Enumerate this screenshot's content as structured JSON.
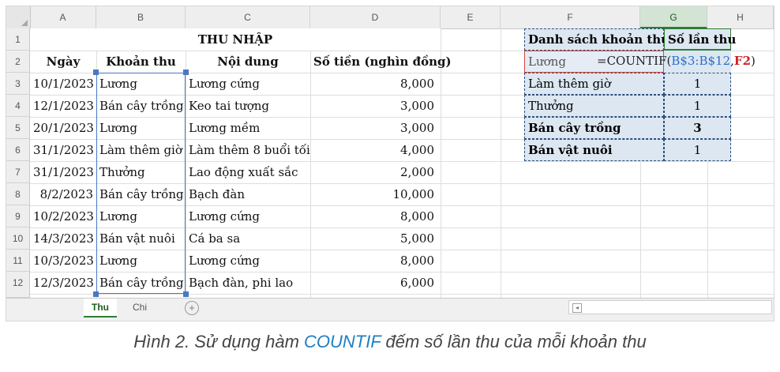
{
  "columns": [
    "A",
    "B",
    "C",
    "D",
    "E",
    "F",
    "G",
    "H"
  ],
  "selected_column": "G",
  "rows": [
    "1",
    "2",
    "3",
    "4",
    "5",
    "6",
    "7",
    "8",
    "9",
    "10",
    "11",
    "12"
  ],
  "title": "THU NHẬP",
  "headers": {
    "ngay": "Ngày",
    "khoan_thu": "Khoản thu",
    "noi_dung": "Nội dung",
    "so_tien": "Số tiền (nghìn đồng)"
  },
  "data_rows": [
    {
      "ngay": "10/1/2023",
      "khoan_thu": "Lương",
      "noi_dung": "Lương cứng",
      "so_tien": "8,000"
    },
    {
      "ngay": "12/1/2023",
      "khoan_thu": "Bán cây trồng",
      "noi_dung": "Keo tai tượng",
      "so_tien": "3,000"
    },
    {
      "ngay": "20/1/2023",
      "khoan_thu": "Lương",
      "noi_dung": "Lương mềm",
      "so_tien": "3,000"
    },
    {
      "ngay": "31/1/2023",
      "khoan_thu": "Làm thêm giờ",
      "noi_dung": "Làm thêm 8 buổi tối",
      "so_tien": "4,000"
    },
    {
      "ngay": "31/1/2023",
      "khoan_thu": "Thưởng",
      "noi_dung": "Lao động xuất sắc",
      "so_tien": "2,000"
    },
    {
      "ngay": "8/2/2023",
      "khoan_thu": "Bán cây trồng",
      "noi_dung": "Bạch đàn",
      "so_tien": "10,000"
    },
    {
      "ngay": "10/2/2023",
      "khoan_thu": "Lương",
      "noi_dung": "Lương cứng",
      "so_tien": "8,000"
    },
    {
      "ngay": "14/3/2023",
      "khoan_thu": "Bán vật nuôi",
      "noi_dung": "Cá ba sa",
      "so_tien": "5,000"
    },
    {
      "ngay": "10/3/2023",
      "khoan_thu": "Lương",
      "noi_dung": "Lương cứng",
      "so_tien": "8,000"
    },
    {
      "ngay": "12/3/2023",
      "khoan_thu": "Bán cây trồng",
      "noi_dung": "Bạch đàn, phi lao",
      "so_tien": "6,000"
    }
  ],
  "summary": {
    "header_list": "Danh sách khoản thu",
    "header_count": "Số lần thu",
    "editing_label": "Lương",
    "formula": {
      "prefix": "=COUNTIF(",
      "range": "B$3:B$12",
      "comma": ",",
      "ref": "F2",
      "suffix": ")"
    },
    "items": [
      {
        "name": "Làm thêm giờ",
        "count": "1"
      },
      {
        "name": "Thưởng",
        "count": "1"
      },
      {
        "name": "Bán cây trồng",
        "count": "3"
      },
      {
        "name": "Bán vật nuôi",
        "count": "1"
      }
    ]
  },
  "sheet_tabs": [
    "Thu",
    "Chi"
  ],
  "active_tab": "Thu",
  "caption": {
    "prefix": "Hình 2. Sử dụng hàm ",
    "function": "COUNTIF",
    "suffix": " đếm số lần thu của mỗi khoản thu"
  },
  "colors": {
    "range_border": "#4a78c2",
    "ref_border": "#d24a3a",
    "formula_range": "#2a6fc9",
    "formula_ref": "#cc2222",
    "table_fill": "#dce7f2",
    "table_border": "#2b4f7a"
  }
}
